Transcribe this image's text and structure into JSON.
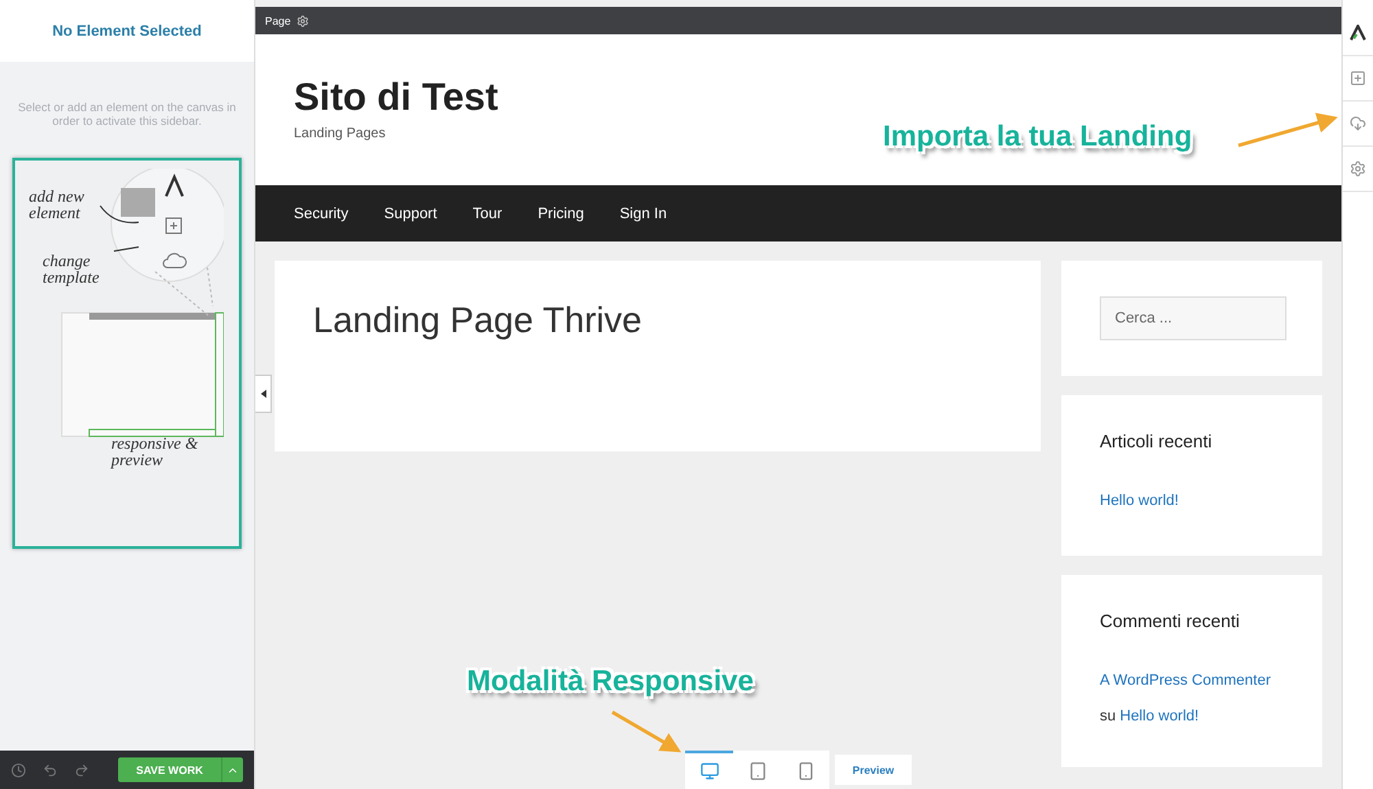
{
  "sidebar": {
    "title": "No Element Selected",
    "hint": "Select or add an element on the canvas in order to activate this sidebar.",
    "illustration": {
      "labels": [
        {
          "kind": "add",
          "text": "add new element"
        },
        {
          "kind": "template",
          "text": "change template"
        },
        {
          "kind": "responsive",
          "text": "responsive & preview"
        }
      ]
    },
    "footer": {
      "save_button": "SAVE WORK"
    }
  },
  "breadcrumb": {
    "label": "Page"
  },
  "site": {
    "title": "Sito di Test",
    "tagline": "Landing Pages",
    "nav": [
      "Security",
      "Support",
      "Tour",
      "Pricing",
      "Sign In"
    ]
  },
  "content": {
    "heading": "Landing Page Thrive"
  },
  "widgets": {
    "search": {
      "placeholder": "Cerca ..."
    },
    "recent_posts": {
      "title": "Articoli recenti",
      "links": [
        "Hello world!"
      ]
    },
    "recent_comments": {
      "title": "Commenti recenti",
      "comments": [
        {
          "author": "A WordPress Commenter",
          "connector": "su",
          "post": "Hello world!"
        }
      ]
    }
  },
  "devices": [
    {
      "kind": "desktop",
      "selected": true
    },
    {
      "kind": "tablet",
      "selected": false
    },
    {
      "kind": "mobile",
      "selected": false
    }
  ],
  "preview_button": "Preview",
  "annotations": [
    {
      "kind": "import",
      "text": "Importa la tua Landing"
    },
    {
      "kind": "responsive",
      "text": "Modalità Responsive"
    }
  ]
}
